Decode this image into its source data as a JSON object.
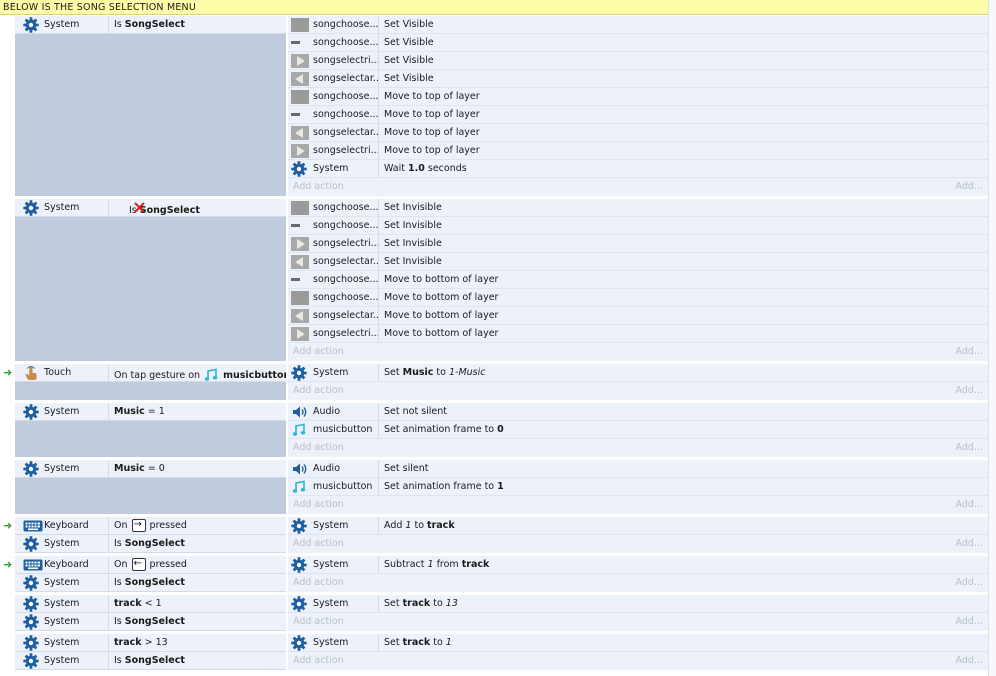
{
  "comment": "BELOW IS THE SONG SELECTION MENU",
  "add_action": "Add action",
  "add_short": "Add...",
  "icon_colors": {
    "gear": "#1f5fa0",
    "audio": "#1f5fa0",
    "music": "#29b6d6",
    "sprite_gray": "#9a9a9a",
    "invert": "#e02020",
    "trigger": "#3a9d3a"
  },
  "events": [
    {
      "trigger": false,
      "conditions": [
        {
          "icon": "gear-icon",
          "object": "System",
          "pre": "Is ",
          "bold": "SongSelect",
          "post": "",
          "inverted": false
        }
      ],
      "actions": [
        {
          "icon": "sprite-box-icon",
          "object": "songchoose...",
          "pre": "Set Visible",
          "bold": "",
          "post": ""
        },
        {
          "icon": "sprite-dash-icon",
          "object": "songchoose...",
          "pre": "Set Visible",
          "bold": "",
          "post": ""
        },
        {
          "icon": "arrow-right-sprite-icon",
          "object": "songselectri...",
          "pre": "Set Visible",
          "bold": "",
          "post": ""
        },
        {
          "icon": "arrow-left-sprite-icon",
          "object": "songselectar...",
          "pre": "Set Visible",
          "bold": "",
          "post": ""
        },
        {
          "icon": "sprite-box-icon",
          "object": "songchoose...",
          "pre": "Move to top of layer",
          "bold": "",
          "post": ""
        },
        {
          "icon": "sprite-dash-icon",
          "object": "songchoose...",
          "pre": "Move to top of layer",
          "bold": "",
          "post": ""
        },
        {
          "icon": "arrow-left-sprite-icon",
          "object": "songselectar...",
          "pre": "Move to top of layer",
          "bold": "",
          "post": ""
        },
        {
          "icon": "arrow-right-sprite-icon",
          "object": "songselectri...",
          "pre": "Move to top of layer",
          "bold": "",
          "post": ""
        },
        {
          "icon": "gear-icon",
          "object": "System",
          "pre": "Wait ",
          "bold": "1.0",
          "post": " seconds"
        }
      ]
    },
    {
      "trigger": false,
      "conditions": [
        {
          "icon": "gear-icon",
          "object": "System",
          "pre": "Is ",
          "bold": "SongSelect",
          "post": "",
          "inverted": true
        }
      ],
      "actions": [
        {
          "icon": "sprite-box-icon",
          "object": "songchoose...",
          "pre": "Set Invisible",
          "bold": "",
          "post": ""
        },
        {
          "icon": "sprite-dash-icon",
          "object": "songchoose...",
          "pre": "Set Invisible",
          "bold": "",
          "post": ""
        },
        {
          "icon": "arrow-right-sprite-icon",
          "object": "songselectri...",
          "pre": "Set Invisible",
          "bold": "",
          "post": ""
        },
        {
          "icon": "arrow-left-sprite-icon",
          "object": "songselectar...",
          "pre": "Set Invisible",
          "bold": "",
          "post": ""
        },
        {
          "icon": "sprite-dash-icon",
          "object": "songchoose...",
          "pre": "Move to bottom of layer",
          "bold": "",
          "post": ""
        },
        {
          "icon": "sprite-box-icon",
          "object": "songchoose...",
          "pre": "Move to bottom of layer",
          "bold": "",
          "post": ""
        },
        {
          "icon": "arrow-left-sprite-icon",
          "object": "songselectar...",
          "pre": "Move to bottom of layer",
          "bold": "",
          "post": ""
        },
        {
          "icon": "arrow-right-sprite-icon",
          "object": "songselectri...",
          "pre": "Move to bottom of layer",
          "bold": "",
          "post": ""
        }
      ]
    },
    {
      "trigger": true,
      "conditions": [
        {
          "icon": "touch-icon",
          "object": "Touch",
          "pre": "On tap gesture on ",
          "bold": "musicbutton",
          "post": "",
          "inverted": false,
          "inline_icon": "music-note-icon"
        }
      ],
      "actions": [
        {
          "icon": "gear-icon",
          "object": "System",
          "pre": "Set ",
          "bold": "Music",
          "post": " to ",
          "italic": "1-Music"
        }
      ]
    },
    {
      "trigger": false,
      "conditions": [
        {
          "icon": "gear-icon",
          "object": "System",
          "pre": "",
          "bold": "Music",
          "post": " = 1",
          "inverted": false
        }
      ],
      "actions": [
        {
          "icon": "audio-icon",
          "object": "Audio",
          "pre": "Set not silent",
          "bold": "",
          "post": ""
        },
        {
          "icon": "music-note-icon",
          "object": "musicbutton",
          "pre": "Set animation frame to ",
          "bold": "0",
          "post": ""
        }
      ]
    },
    {
      "trigger": false,
      "conditions": [
        {
          "icon": "gear-icon",
          "object": "System",
          "pre": "",
          "bold": "Music",
          "post": " = 0",
          "inverted": false
        }
      ],
      "actions": [
        {
          "icon": "audio-icon",
          "object": "Audio",
          "pre": "Set silent",
          "bold": "",
          "post": ""
        },
        {
          "icon": "music-note-icon",
          "object": "musicbutton",
          "pre": "Set animation frame to ",
          "bold": "1",
          "post": ""
        }
      ]
    },
    {
      "trigger": true,
      "conditions": [
        {
          "icon": "keyboard-icon",
          "object": "Keyboard",
          "pre": "On ",
          "key": "→",
          "post": " pressed",
          "bold": "",
          "inverted": false
        },
        {
          "icon": "gear-icon",
          "object": "System",
          "pre": "Is ",
          "bold": "SongSelect",
          "post": "",
          "inverted": false
        }
      ],
      "actions": [
        {
          "icon": "gear-icon",
          "object": "System",
          "pre": "Add ",
          "italic": "1",
          "post": " to ",
          "bold": "track"
        }
      ]
    },
    {
      "trigger": true,
      "conditions": [
        {
          "icon": "keyboard-icon",
          "object": "Keyboard",
          "pre": "On ",
          "key": "←",
          "post": " pressed",
          "bold": "",
          "inverted": false
        },
        {
          "icon": "gear-icon",
          "object": "System",
          "pre": "Is ",
          "bold": "SongSelect",
          "post": "",
          "inverted": false
        }
      ],
      "actions": [
        {
          "icon": "gear-icon",
          "object": "System",
          "pre": "Subtract ",
          "italic": "1",
          "post": " from ",
          "bold": "track"
        }
      ]
    },
    {
      "trigger": false,
      "conditions": [
        {
          "icon": "gear-icon",
          "object": "System",
          "pre": "",
          "bold": "track",
          "post": " < 1",
          "inverted": false
        },
        {
          "icon": "gear-icon",
          "object": "System",
          "pre": "Is ",
          "bold": "SongSelect",
          "post": "",
          "inverted": false
        }
      ],
      "actions": [
        {
          "icon": "gear-icon",
          "object": "System",
          "pre": "Set ",
          "bold": "track",
          "post": " to ",
          "italic": "13"
        }
      ]
    },
    {
      "trigger": false,
      "conditions": [
        {
          "icon": "gear-icon",
          "object": "System",
          "pre": "",
          "bold": "track",
          "post": " > 13",
          "inverted": false
        },
        {
          "icon": "gear-icon",
          "object": "System",
          "pre": "Is ",
          "bold": "SongSelect",
          "post": "",
          "inverted": false
        }
      ],
      "actions": [
        {
          "icon": "gear-icon",
          "object": "System",
          "pre": "Set ",
          "bold": "track",
          "post": " to ",
          "italic": "1"
        }
      ]
    }
  ]
}
